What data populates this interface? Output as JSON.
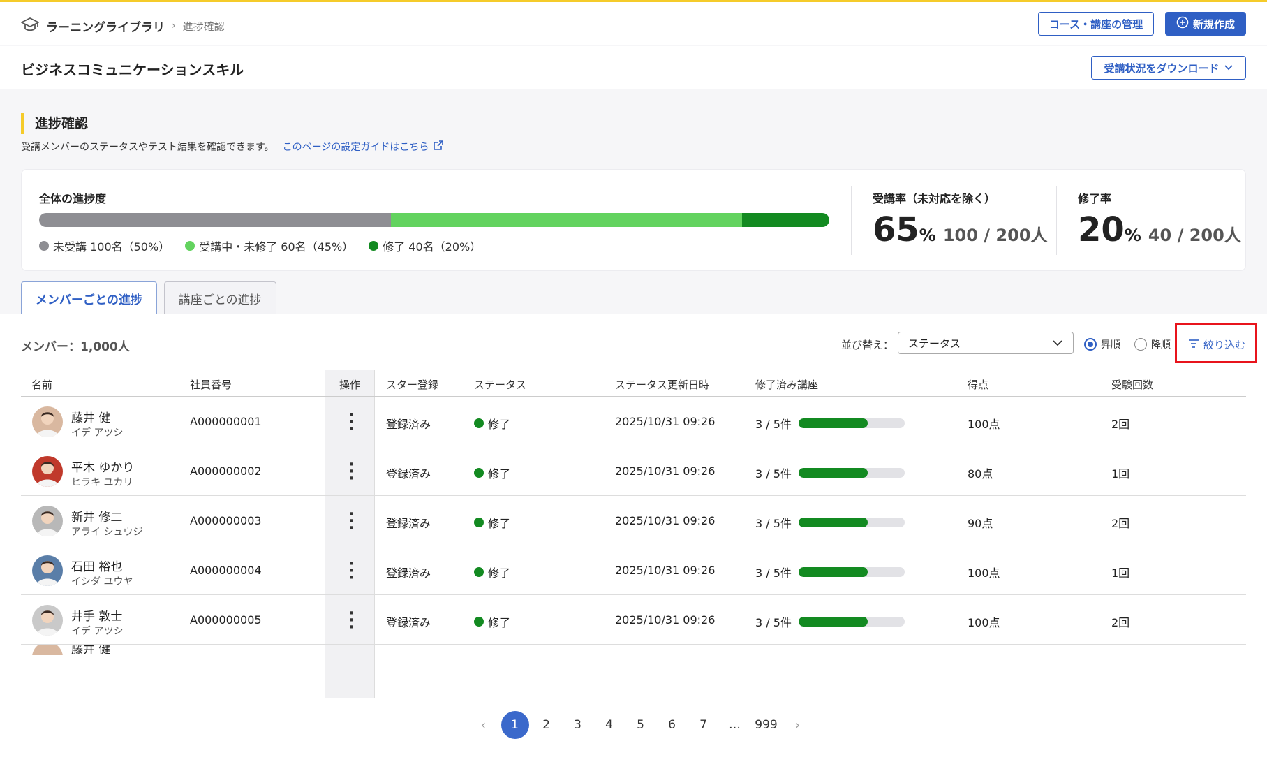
{
  "header": {
    "app_name": "ラーニングライブラリ",
    "breadcrumb_current": "進捗確認",
    "manage_button": "コース・講座の管理",
    "new_button": "新規作成"
  },
  "page": {
    "title": "ビジネスコミュニケーションスキル",
    "download_button": "受講状況をダウンロード"
  },
  "section": {
    "title": "進捗確認",
    "description": "受講メンバーのステータスやテスト結果を確認できます。",
    "guide_link": "このページの設定ガイドはこちら"
  },
  "progress": {
    "label": "全体の進捗度",
    "segments": [
      {
        "label": "未受講 100名（50%）",
        "fraction": 0.445,
        "color": "#8e8e93"
      },
      {
        "label": "受講中・未修了 60名（45%）",
        "fraction": 0.445,
        "color": "#63d35f"
      },
      {
        "label": "修了 40名（20%）",
        "fraction": 0.11,
        "color": "#138a21"
      }
    ],
    "attendance_label": "受講率（未対応を除く）",
    "attendance_value": "65",
    "attendance_unit": "%",
    "attendance_sub": "100 / 200人",
    "completion_label": "修了率",
    "completion_value": "20",
    "completion_unit": "%",
    "completion_sub": "40 / 200人"
  },
  "tabs": [
    {
      "label": "メンバーごとの進捗",
      "active": true
    },
    {
      "label": "講座ごとの進捗",
      "active": false
    }
  ],
  "toolbar": {
    "member_count": "メンバー：1,000人",
    "sort_label": "並び替え：",
    "sort_value": "ステータス",
    "asc_label": "昇順",
    "desc_label": "降順",
    "filter_label": "絞り込む"
  },
  "table": {
    "headers": [
      "名前",
      "社員番号",
      "操作",
      "スター登録",
      "ステータス",
      "ステータス更新日時",
      "修了済み講座",
      "得点",
      "受験回数"
    ],
    "rows": [
      {
        "name": "藤井 健",
        "kana": "イデ アツシ",
        "id": "A000000001",
        "star": "登録済み",
        "status": "修了",
        "updated": "2025/10/31 09:26",
        "done": "3 / 5件",
        "done_fraction": 0.65,
        "score": "100点",
        "attempts": "2回",
        "avatar_color": "#d9b8a0"
      },
      {
        "name": "平木 ゆかり",
        "kana": "ヒラキ ユカリ",
        "id": "A000000002",
        "star": "登録済み",
        "status": "修了",
        "updated": "2025/10/31 09:26",
        "done": "3 / 5件",
        "done_fraction": 0.65,
        "score": "80点",
        "attempts": "1回",
        "avatar_color": "#c0392b"
      },
      {
        "name": "新井 修二",
        "kana": "アライ シュウジ",
        "id": "A000000003",
        "star": "登録済み",
        "status": "修了",
        "updated": "2025/10/31 09:26",
        "done": "3 / 5件",
        "done_fraction": 0.65,
        "score": "90点",
        "attempts": "2回",
        "avatar_color": "#b8b8b8"
      },
      {
        "name": "石田 裕也",
        "kana": "イシダ ユウヤ",
        "id": "A000000004",
        "star": "登録済み",
        "status": "修了",
        "updated": "2025/10/31 09:26",
        "done": "3 / 5件",
        "done_fraction": 0.65,
        "score": "100点",
        "attempts": "1回",
        "avatar_color": "#5a7ea8"
      },
      {
        "name": "井手 敦士",
        "kana": "イデ アツシ",
        "id": "A000000005",
        "star": "登録済み",
        "status": "修了",
        "updated": "2025/10/31 09:26",
        "done": "3 / 5件",
        "done_fraction": 0.65,
        "score": "100点",
        "attempts": "2回",
        "avatar_color": "#c9c9c9"
      }
    ],
    "partial_row_name": "藤井 健"
  },
  "pagination": {
    "pages": [
      "1",
      "2",
      "3",
      "4",
      "5",
      "6",
      "7",
      "…",
      "999"
    ],
    "current": "1"
  },
  "colors": {
    "accent": "#2f5fc4",
    "highlight": "#f5cb2a",
    "complete": "#138a21",
    "filter_outline": "#e8141c"
  }
}
